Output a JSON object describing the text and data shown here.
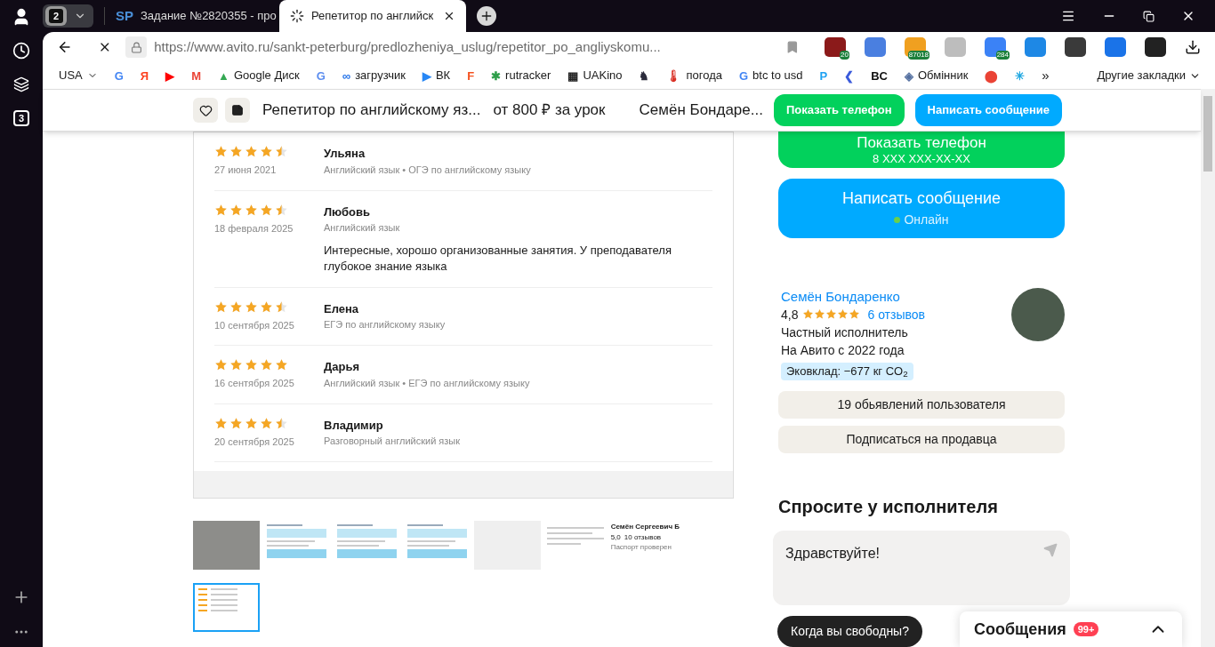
{
  "browser": {
    "sidebar_badge": "3",
    "tab_count": "2",
    "tabs": [
      {
        "icon_text": "SP",
        "title": "Задание №2820355 - про",
        "selected": false,
        "loading": false
      },
      {
        "title": "Репетитор по английск",
        "selected": true,
        "loading": true
      }
    ],
    "url": "https://www.avito.ru/sankt-peterburg/predlozheniya_uslug/repetitor_po_angliyskomu...",
    "extensions": [
      {
        "color": "#8b1a1a",
        "badge": "20"
      },
      {
        "color": "#4a7fe0"
      },
      {
        "color": "#f0a020",
        "badge": "87018"
      },
      {
        "color": "#bdbdbd"
      },
      {
        "color": "#3b82f6",
        "badge": "284"
      },
      {
        "color": "#1e88e5"
      },
      {
        "color": "#3a3a3a"
      },
      {
        "color": "#1a73e8"
      },
      {
        "color": "#222222"
      }
    ],
    "bookmarks": [
      {
        "label": "USA"
      },
      {
        "glyph": "G",
        "color": "#4285f4"
      },
      {
        "glyph": "Я",
        "color": "#fc3f1d"
      },
      {
        "glyph": "▶",
        "color": "#ff0000"
      },
      {
        "glyph": "M",
        "color": "#ea4335"
      },
      {
        "glyph": "▲",
        "label": "Google Диск",
        "color": "#34a853"
      },
      {
        "glyph": "G",
        "color": "#5b8def"
      },
      {
        "glyph": "∞",
        "label": "загрузчик",
        "color": "#1e6fe8"
      },
      {
        "glyph": "▶",
        "label": "ВК",
        "color": "#2787f5"
      },
      {
        "glyph": "F",
        "color": "#f4511e"
      },
      {
        "glyph": "✱",
        "label": "rutracker",
        "color": "#2e9e4a"
      },
      {
        "glyph": "▦",
        "label": "UAKino",
        "color": "#222222"
      },
      {
        "glyph": "♞",
        "color": "#2b2b3b"
      },
      {
        "glyph": "🌡",
        "label": "погода",
        "color": "#d93025"
      },
      {
        "glyph": "G",
        "label": "btc to usd",
        "color": "#4285f4"
      },
      {
        "glyph": "P",
        "color": "#1da1f2"
      },
      {
        "glyph": "❮",
        "color": "#3b5bdb"
      },
      {
        "glyph": "BC",
        "color": "#111111"
      },
      {
        "glyph": "◈",
        "label": "Обмінник",
        "color": "#5470a0"
      },
      {
        "glyph": "⬤",
        "color": "#ea4335"
      },
      {
        "glyph": "✳",
        "color": "#1ea7e1"
      }
    ],
    "more_bookmarks": "»",
    "other_bookmarks": "Другие закладки"
  },
  "header": {
    "title": "Репетитор по английскому яз...",
    "price": "от 800 ₽ за урок",
    "seller": "Семён Бондаре...",
    "phone_button": "Показать телефон",
    "message_button": "Написать сообщение"
  },
  "gallery": {
    "reviews": [
      {
        "name": "Ульяна",
        "stars": 4.5,
        "date": "27 июня 2021",
        "subjects": "Английский язык • ОГЭ по английскому языку"
      },
      {
        "name": "Любовь",
        "stars": 4.5,
        "date": "18 февраля 2025",
        "subjects": "Английский язык",
        "text": "Интересные, хорошо организованные занятия. У преподавателя глубокое знание языка"
      },
      {
        "name": "Елена",
        "stars": 4.5,
        "date": "10 сентября 2025",
        "subjects": "ЕГЭ по английскому языку"
      },
      {
        "name": "Дарья",
        "stars": 5,
        "date": "16 сентября 2025",
        "subjects": "Английский язык • ЕГЭ по английскому языку"
      },
      {
        "name": "Владимир",
        "stars": 4.5,
        "date": "20 сентября 2025",
        "subjects": "Разговорный английский язык"
      }
    ],
    "thumbnails": [
      {
        "kind": "photo",
        "selected": false
      },
      {
        "kind": "document",
        "selected": false
      },
      {
        "kind": "document",
        "selected": false
      },
      {
        "kind": "document",
        "selected": false
      },
      {
        "kind": "blank",
        "selected": false
      },
      {
        "kind": "profile",
        "selected": false,
        "name": "Семён Сергеевич Б",
        "rating": "5,0",
        "reviews": "10 отзывов",
        "note": "Паспорт проверен"
      },
      {
        "kind": "reviews",
        "selected": true
      }
    ]
  },
  "contact": {
    "phone_button": "Показать телефон",
    "phone": "8 XXX XXX-XX-XX",
    "message_button": "Написать сообщение",
    "online": "Онлайн"
  },
  "seller": {
    "name": "Семён Бондаренко",
    "rating": "4,8",
    "stars": 5,
    "reviews": "6 отзывов",
    "type": "Частный исполнитель",
    "since": "На Авито с 2022 года",
    "eco": "Эковклад: −677 кг CO$_{2}$",
    "listings_button": "19 обьявлений пользователя",
    "subscribe_button": "Подписаться на продавца"
  },
  "ask": {
    "title": "Спросите у исполнителя",
    "value": "Здравствуйте!",
    "suggestion": "Когда вы свободны?"
  },
  "messages": {
    "title": "Сообщения",
    "badge": "99+"
  }
}
